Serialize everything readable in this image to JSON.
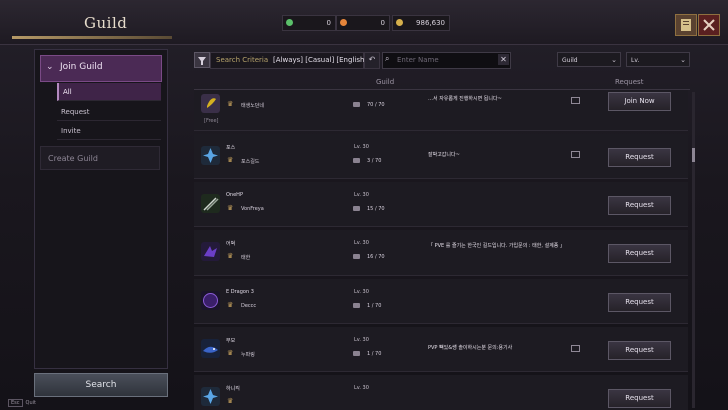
{
  "header": {
    "title": "Guild",
    "currencies": [
      {
        "name": "green-gem",
        "value": "0",
        "color": "#5bc06a"
      },
      {
        "name": "orange-flag",
        "value": "0",
        "color": "#e7863b"
      },
      {
        "name": "gold-coin",
        "value": "986,630",
        "color": "#d6b04c"
      }
    ]
  },
  "sidebar": {
    "section": "Join Guild",
    "items": [
      "All",
      "Request",
      "Invite"
    ],
    "active": "All",
    "create": "Create Guild",
    "search": "Search"
  },
  "filters": {
    "criteria_label": "Search Criteria",
    "criteria_value": "[Always] [Casual] [English]",
    "search_placeholder": "Enter Name",
    "dropdown1": "Guild",
    "dropdown2": "Lv."
  },
  "columns": {
    "guild": "Guild",
    "request": "Request"
  },
  "rows": [
    {
      "name": "",
      "leader": "태생노던네",
      "level": "",
      "members": "70 / 70",
      "description": "…서 자유롭게 진행하시면 됩니다~",
      "desc_top": "",
      "button": "Join Now",
      "tag": "[Free]",
      "emblem_color": "#c8a020"
    },
    {
      "name": "포스",
      "leader": "포스길드",
      "level": "Lv.  30",
      "members": "3 / 70",
      "description": "잘박고갑니다~",
      "button": "Request",
      "emblem_color": "#5aa6e6"
    },
    {
      "name": "OneHP",
      "leader": "VonFreya",
      "level": "Lv.  30",
      "members": "15 / 70",
      "description": "",
      "button": "Request",
      "emblem_color": "#3a7a3a"
    },
    {
      "name": "어벅",
      "leader": "태한",
      "level": "Lv.  30",
      "members": "16 / 70",
      "description": "「 PVE 를 즐기는 한국인 길드입니다. 가입문의 : 태한, 설계종 」",
      "button": "Request",
      "emblem_color": "#6b3ec8"
    },
    {
      "name": "E Dragon 3",
      "leader": "Deccc",
      "level": "Lv.  30",
      "members": "1 / 70",
      "description": "",
      "button": "Request",
      "emblem_color": "#5a2f9a"
    },
    {
      "name": "부모",
      "leader": "누파링",
      "level": "Lv.  30",
      "members": "1 / 70",
      "description": "PVP 빽있&쌩 솔이하시는분 문의:용기사",
      "button": "Request",
      "emblem_color": "#3a64c8"
    },
    {
      "name": "하니킥",
      "leader": "",
      "level": "Lv.  30",
      "members": "",
      "description": "",
      "button": "Request",
      "emblem_color": "#5aa6e6"
    }
  ],
  "hints": {
    "key": "Esc",
    "label": "Quit"
  }
}
